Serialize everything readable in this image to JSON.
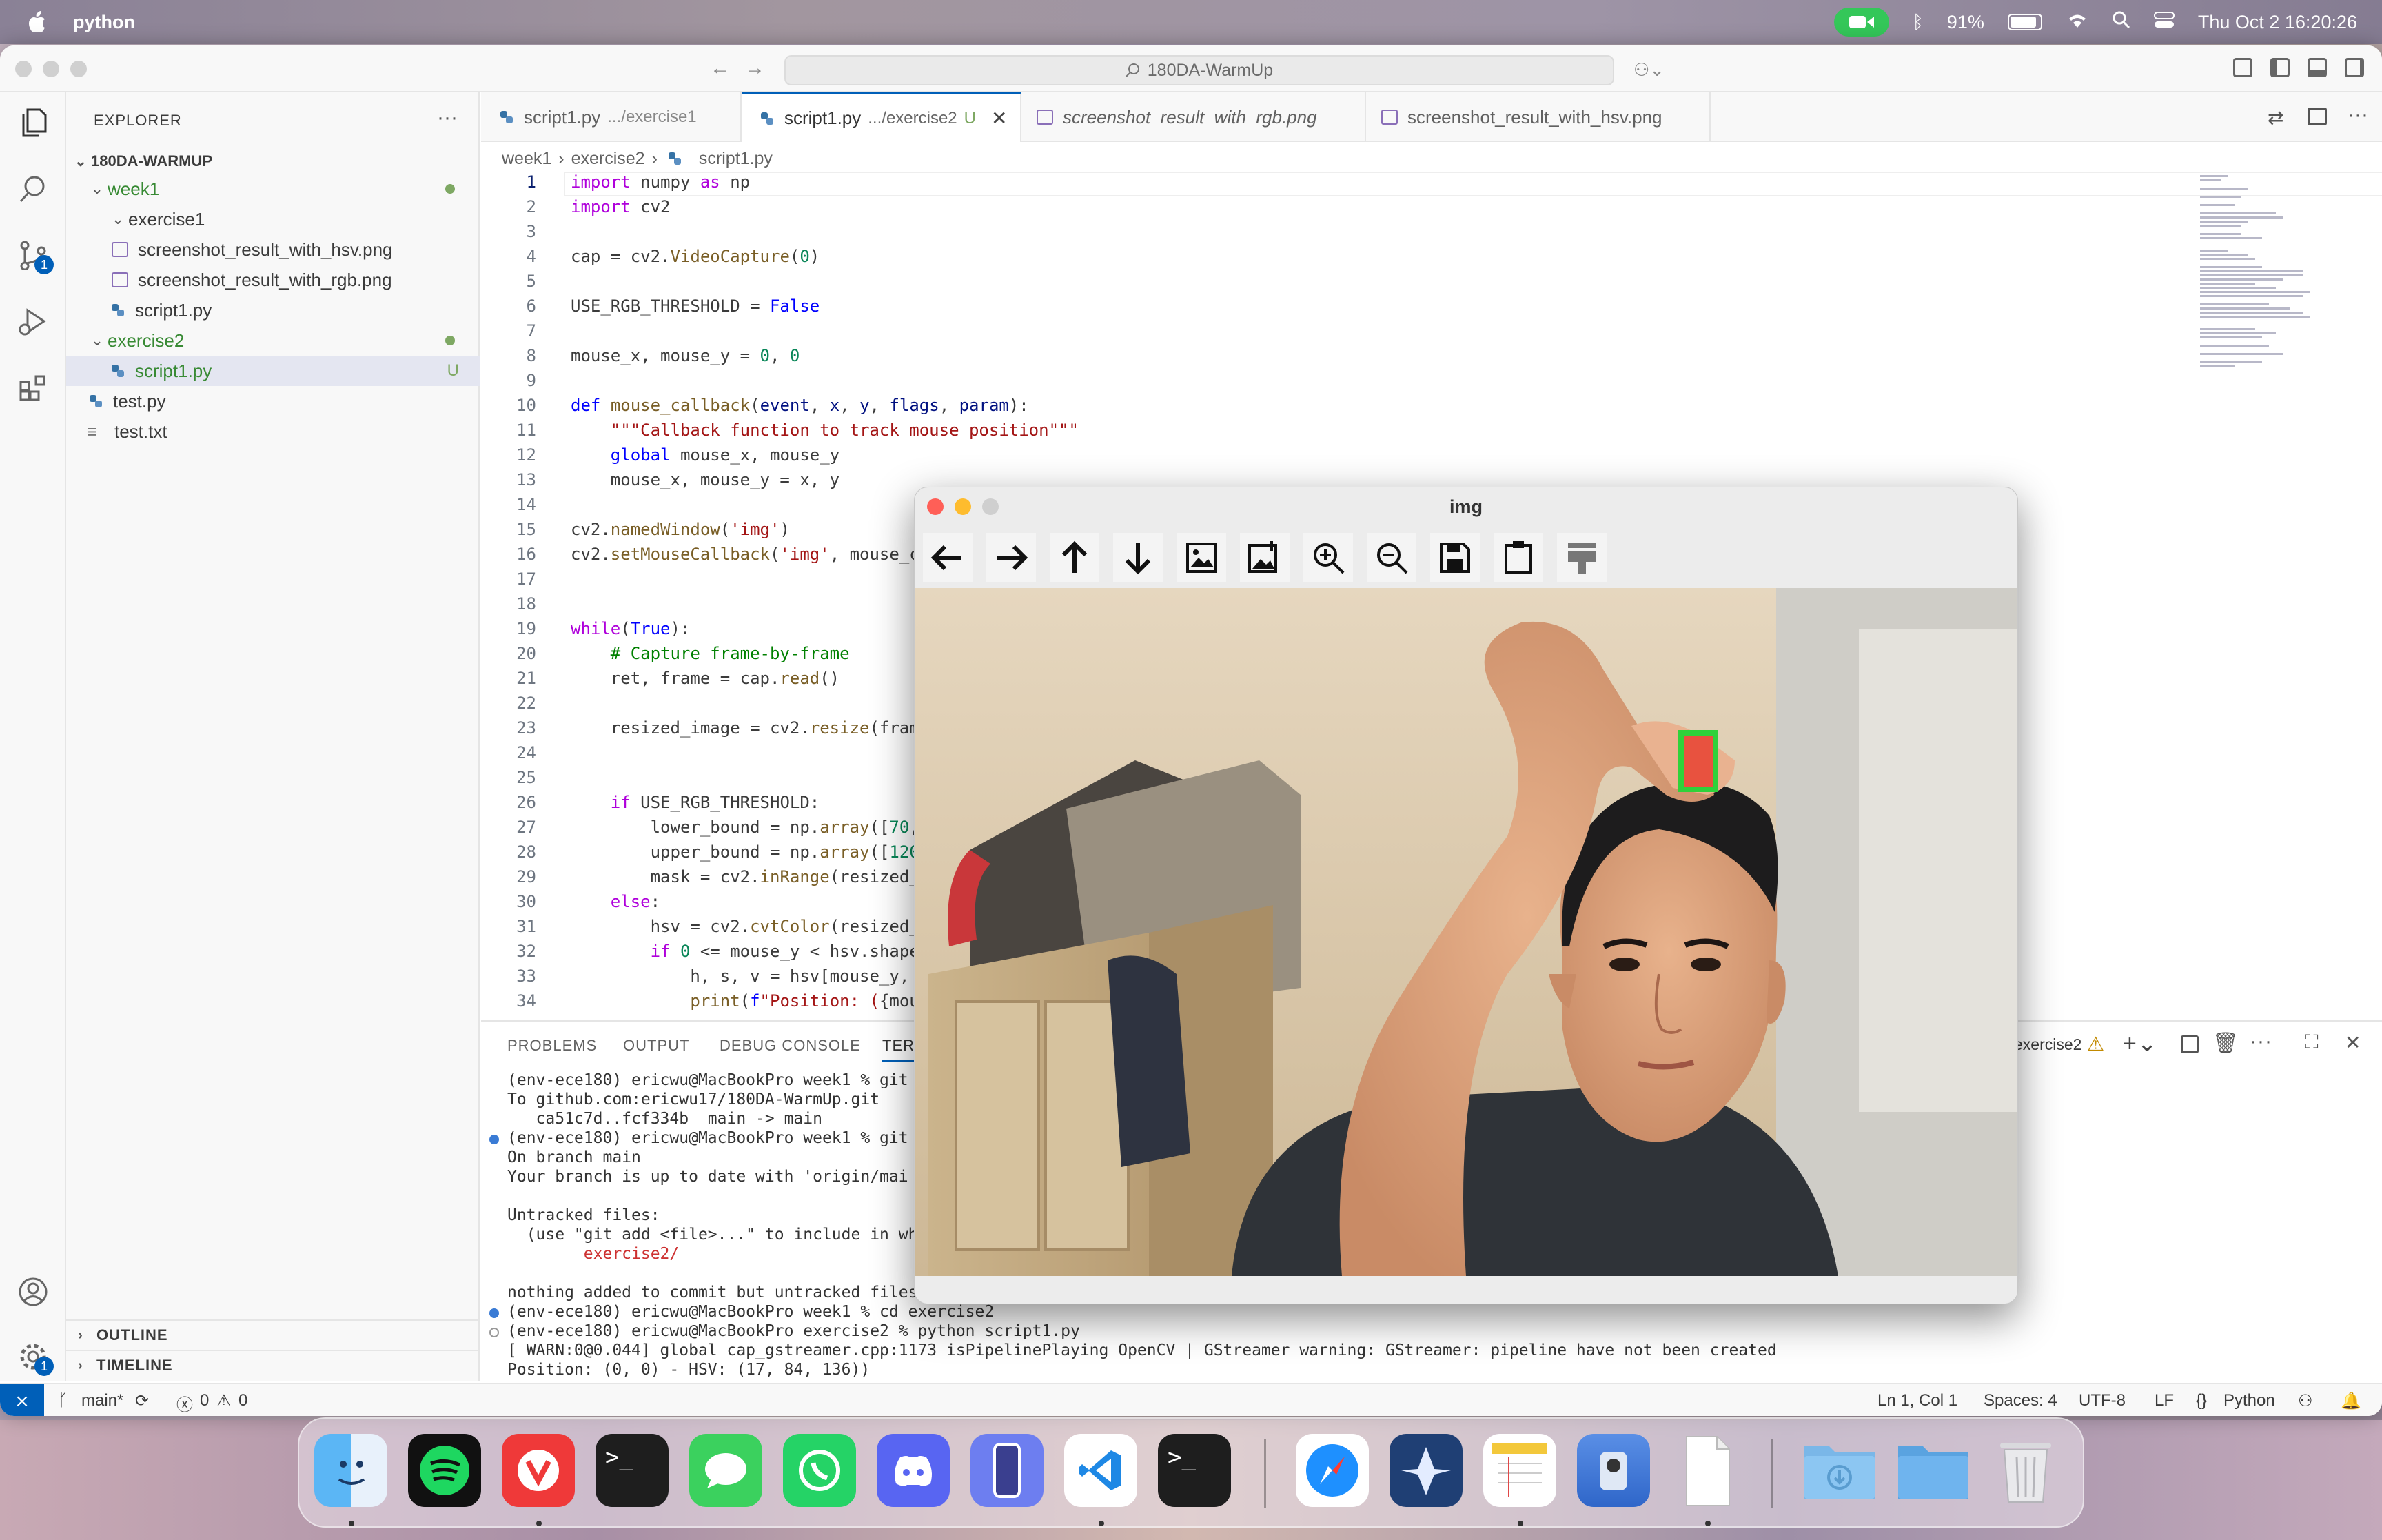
{
  "menubar": {
    "app": "python",
    "battery": "91%",
    "datetime": "Thu Oct 2  16:20:26"
  },
  "window": {
    "search": "180DA-WarmUp"
  },
  "sidebar": {
    "title": "EXPLORER",
    "root": "180DA-WARMUP",
    "items": [
      {
        "label": "week1",
        "type": "folder"
      },
      {
        "label": "exercise1",
        "type": "folder"
      },
      {
        "label": "screenshot_result_with_hsv.png",
        "type": "png"
      },
      {
        "label": "screenshot_result_with_rgb.png",
        "type": "png"
      },
      {
        "label": "script1.py",
        "type": "py"
      },
      {
        "label": "exercise2",
        "type": "folder"
      },
      {
        "label": "script1.py",
        "type": "py",
        "badge": "U"
      },
      {
        "label": "test.py",
        "type": "py"
      },
      {
        "label": "test.txt",
        "type": "txt"
      }
    ],
    "outline": "OUTLINE",
    "timeline": "TIMELINE"
  },
  "tabs": [
    {
      "name": "script1.py",
      "path": ".../exercise1"
    },
    {
      "name": "script1.py",
      "path": ".../exercise2",
      "mod": "U"
    },
    {
      "name": "screenshot_result_with_rgb.png"
    },
    {
      "name": "screenshot_result_with_hsv.png"
    }
  ],
  "breadcrumb": [
    "week1",
    "exercise2",
    "script1.py"
  ],
  "code_line_numbers": [
    "1",
    "2",
    "3",
    "4",
    "5",
    "6",
    "7",
    "8",
    "9",
    "10",
    "11",
    "12",
    "13",
    "14",
    "15",
    "16",
    "17",
    "18",
    "19",
    "20",
    "21",
    "22",
    "23",
    "24",
    "25",
    "26",
    "27",
    "28",
    "29",
    "30",
    "31",
    "32",
    "33",
    "34"
  ],
  "panel": {
    "tabs": [
      "PROBLEMS",
      "OUTPUT",
      "DEBUG CONSOLE",
      "TERM"
    ],
    "terminal_name": "exercise2",
    "lines": [
      "(env-ece180) ericwu@MacBookPro week1 % git",
      "To github.com:ericwu17/180DA-WarmUp.git",
      "   ca51c7d..fcf334b  main -> main",
      "(env-ece180) ericwu@MacBookPro week1 % git",
      "On branch main",
      "Your branch is up to date with 'origin/mai",
      "",
      "Untracked files:",
      "  (use \"git add <file>...\" to include in wh",
      "        exercise2/",
      "",
      "nothing added to commit but untracked files",
      "(env-ece180) ericwu@MacBookPro week1 % cd exercise2",
      "(env-ece180) ericwu@MacBookPro exercise2 % python script1.py",
      "[ WARN:0@0.044] global cap_gstreamer.cpp:1173 isPipelinePlaying OpenCV | GStreamer warning: GStreamer: pipeline have not been created",
      "Position: (0, 0) - HSV: (17, 84, 136))"
    ]
  },
  "status": {
    "branch": "main*",
    "problems": "0",
    "warnings": "0",
    "position": "Ln 1, Col 1",
    "spaces": "Spaces: 4",
    "encoding": "UTF-8",
    "eol": "LF",
    "language": "Python"
  },
  "imgwin": {
    "title": "img"
  },
  "colors": {
    "accent": "#005fb8",
    "keyword": "#0000ff",
    "control": "#af00db",
    "string": "#a31515",
    "number": "#098658",
    "comment": "#008000"
  }
}
